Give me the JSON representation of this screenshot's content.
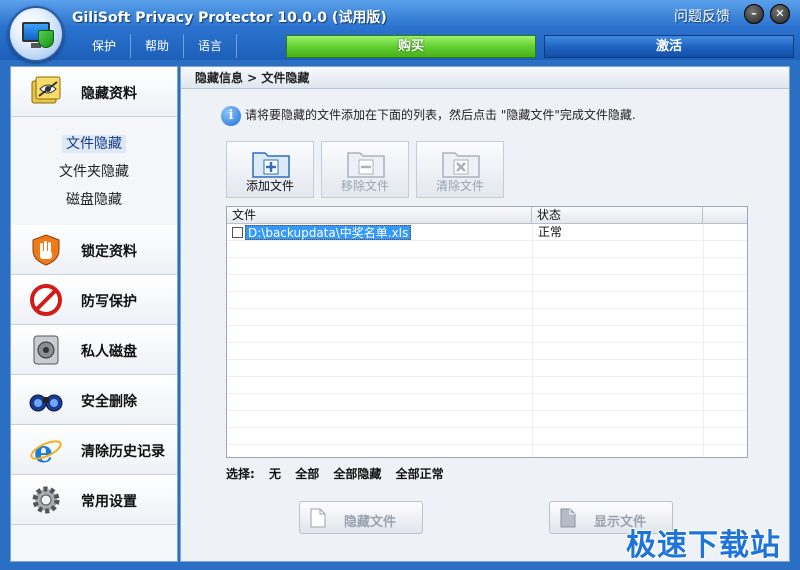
{
  "window": {
    "title": "GiliSoft Privacy Protector 10.0.0 (试用版)",
    "feedback_label": "问题反馈",
    "minimize_glyph": "–",
    "close_glyph": "✕"
  },
  "menu": {
    "items": [
      {
        "label": "保护"
      },
      {
        "label": "帮助"
      },
      {
        "label": "语言"
      }
    ],
    "buy_label": "购买",
    "activate_label": "激活"
  },
  "sidebar": {
    "sections": [
      {
        "label": "隐藏资料",
        "icon": "hide-data-icon"
      },
      {
        "label": "锁定资料",
        "icon": "lock-hand-icon"
      },
      {
        "label": "防写保护",
        "icon": "no-entry-icon"
      },
      {
        "label": "私人磁盘",
        "icon": "safe-disk-icon"
      },
      {
        "label": "安全删除",
        "icon": "binoculars-icon"
      },
      {
        "label": "清除历史记录",
        "icon": "ie-browser-icon"
      },
      {
        "label": "常用设置",
        "icon": "gear-icon"
      }
    ],
    "sub_items": [
      {
        "label": "文件隐藏",
        "active": true
      },
      {
        "label": "文件夹隐藏",
        "active": false
      },
      {
        "label": "磁盘隐藏",
        "active": false
      }
    ]
  },
  "main": {
    "breadcrumb": "隐藏信息 > 文件隐藏",
    "info_text": "请将要隐藏的文件添加在下面的列表，然后点击 \"隐藏文件\"完成文件隐藏.",
    "toolbar": {
      "add_label": "添加文件",
      "remove_label": "移除文件",
      "clear_label": "清除文件"
    },
    "table": {
      "columns": [
        "文件",
        "状态"
      ],
      "rows": [
        {
          "file": "D:\\backupdata\\中奖名单.xls",
          "status": "正常",
          "checked": false
        }
      ]
    },
    "select": {
      "label": "选择:",
      "options": [
        "无",
        "全部",
        "全部隐藏",
        "全部正常"
      ]
    },
    "hide_button_label": "隐藏文件",
    "show_button_label": "显示文件"
  },
  "watermark": "极速下载站",
  "colors": {
    "titlebar": "#2b73cf",
    "buy": "#5fcb2f",
    "activate": "#1e62bf",
    "selection": "#3399ff"
  }
}
